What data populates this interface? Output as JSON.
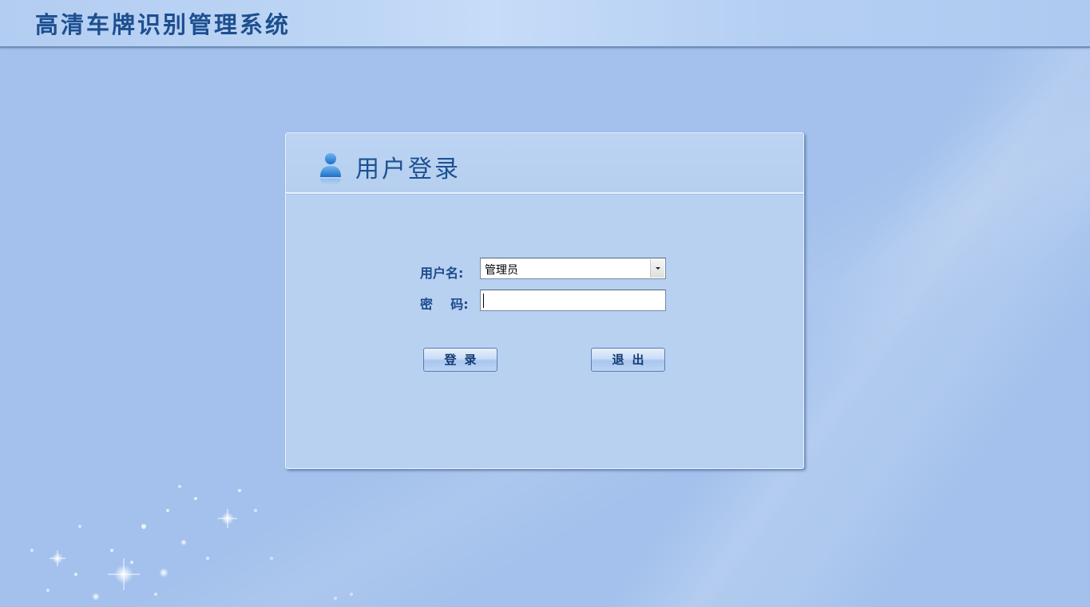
{
  "header": {
    "title": "高清车牌识别管理系统"
  },
  "login": {
    "title": "用户登录",
    "username_label": "用户名:",
    "password_label": "密    码:",
    "username_value": "管理员",
    "password_value": "",
    "login_button": "登录",
    "exit_button": "退出"
  },
  "icons": {
    "user": "user-icon",
    "dropdown": "chevron-down-icon"
  },
  "colors": {
    "background": "#a3c1ec",
    "panel": "#b8d1f1",
    "title_text": "#1d4f8f",
    "label_text": "#1c4b8c"
  }
}
